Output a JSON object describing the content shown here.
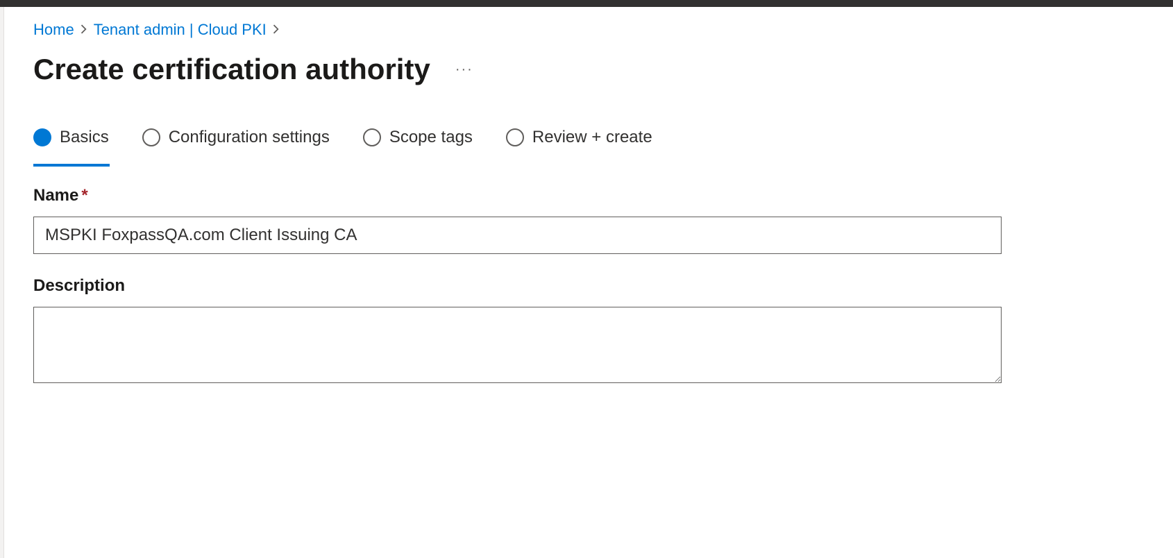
{
  "breadcrumb": {
    "home": "Home",
    "tenant": "Tenant admin | Cloud PKI"
  },
  "page": {
    "title": "Create certification authority"
  },
  "tabs": {
    "basics": "Basics",
    "config": "Configuration settings",
    "scope": "Scope tags",
    "review": "Review + create"
  },
  "form": {
    "name_label": "Name",
    "name_value": "MSPKI FoxpassQA.com Client Issuing CA",
    "description_label": "Description",
    "description_value": ""
  }
}
